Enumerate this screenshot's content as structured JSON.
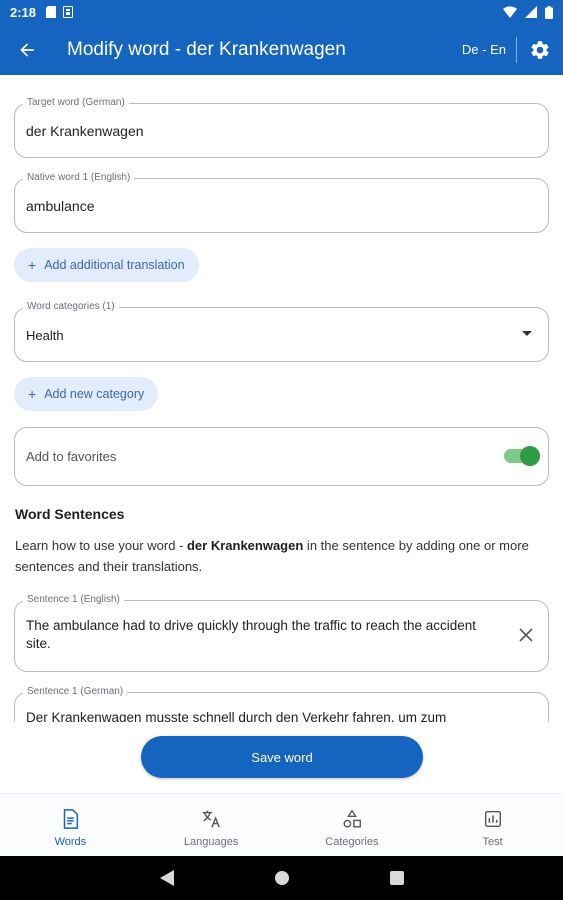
{
  "status_bar": {
    "time": "2:18"
  },
  "app_bar": {
    "title": "Modify word - der Krankenwagen",
    "language_pair": "De - En",
    "back_icon": "arrow-back-icon",
    "settings_icon": "gear-icon"
  },
  "form": {
    "target_word": {
      "label": "Target word (German)",
      "value": "der Krankenwagen"
    },
    "native_word": {
      "label": "Native word 1 (English)",
      "value": "ambulance"
    },
    "add_translation_label": "Add additional translation",
    "categories": {
      "label": "Word categories (1)",
      "value": "Health"
    },
    "add_category_label": "Add new category",
    "favorites": {
      "label": "Add to favorites",
      "enabled": true
    }
  },
  "sentences": {
    "title": "Word Sentences",
    "desc_prefix": "Learn how to use your word - ",
    "desc_word": "der Krankenwagen",
    "desc_suffix": " in the sentence by adding one or more sentences and their translations.",
    "items": [
      {
        "label": "Sentence 1 (English)",
        "value": "The ambulance had to drive quickly through the traffic to reach the accident site."
      },
      {
        "label": "Sentence 1 (German)",
        "value": "Der Krankenwagen musste schnell durch den Verkehr fahren, um zum"
      }
    ]
  },
  "save_label": "Save word",
  "bottom_nav": {
    "tabs": [
      {
        "label": "Words",
        "active": true
      },
      {
        "label": "Languages",
        "active": false
      },
      {
        "label": "Categories",
        "active": false
      },
      {
        "label": "Test",
        "active": false
      }
    ]
  },
  "colors": {
    "primary": "#1565c0",
    "chip_bg": "#e3ecfa",
    "toggle_on": "#2e9c44"
  }
}
